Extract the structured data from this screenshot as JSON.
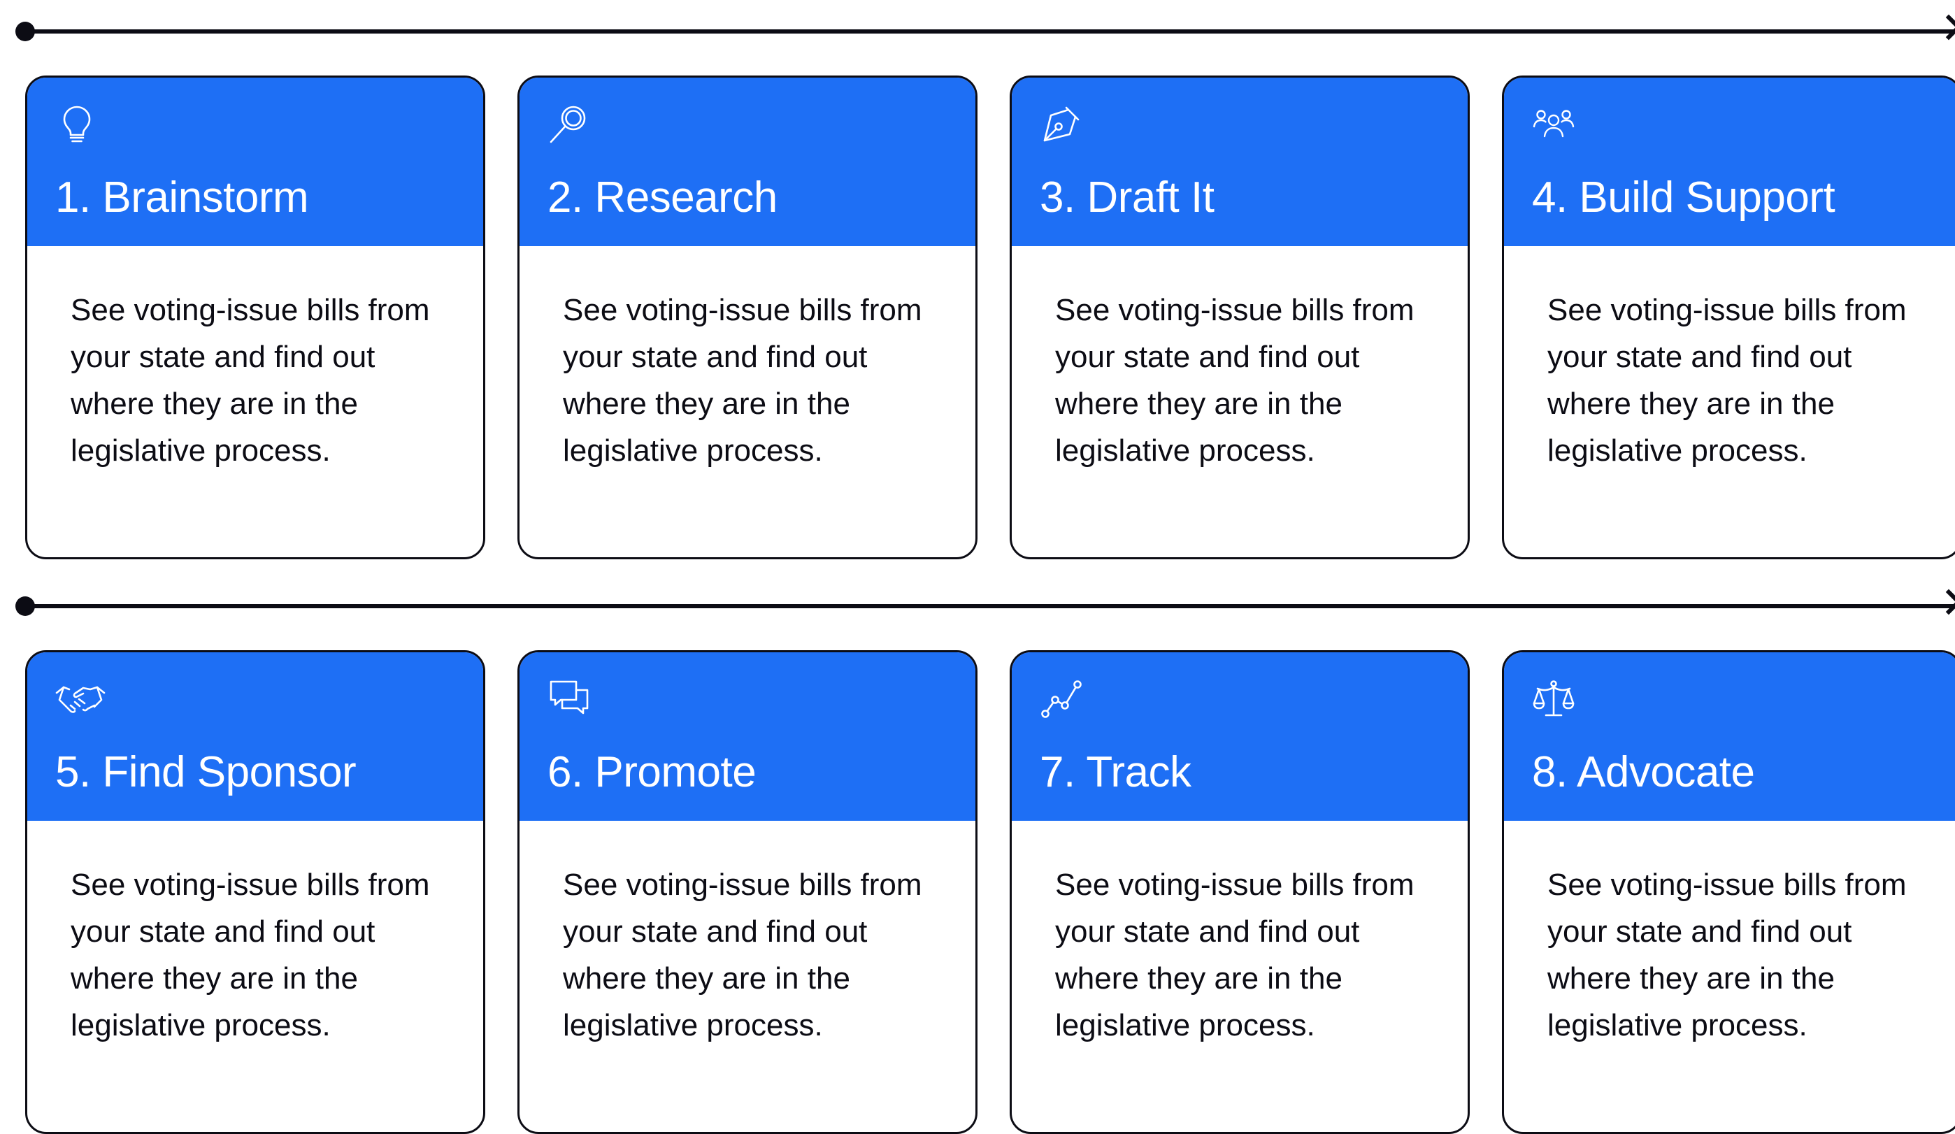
{
  "colors": {
    "accent": "#1e6ff5",
    "ink": "#0c0c14",
    "background": "#ffffff"
  },
  "rows": [
    {
      "cards": [
        {
          "title": "1. Brainstorm",
          "icon": "lightbulb-icon",
          "body": "See voting-issue bills from your state and find out where they are in the legislative process."
        },
        {
          "title": "2. Research",
          "icon": "magnifier-icon",
          "body": "See voting-issue bills from your state and find out where they are in the legislative process."
        },
        {
          "title": "3. Draft It",
          "icon": "pen-nib-icon",
          "body": "See voting-issue bills from your state and find out where they are in the legislative process."
        },
        {
          "title": "4. Build Support",
          "icon": "people-group-icon",
          "body": "See voting-issue bills from your state and find out where they are in the legislative process."
        }
      ]
    },
    {
      "cards": [
        {
          "title": "5. Find Sponsor",
          "icon": "handshake-icon",
          "body": "See voting-issue bills from your state and find out where they are in the legislative process."
        },
        {
          "title": "6. Promote",
          "icon": "chat-bubbles-icon",
          "body": "See voting-issue bills from your state and find out where they are in the legislative process."
        },
        {
          "title": "7. Track",
          "icon": "line-graph-icon",
          "body": "See voting-issue bills from your state and find out where they are in the legislative process."
        },
        {
          "title": "8. Advocate",
          "icon": "scales-icon",
          "body": "See voting-issue bills from your state and find out where they are in the legislative process."
        }
      ]
    }
  ]
}
